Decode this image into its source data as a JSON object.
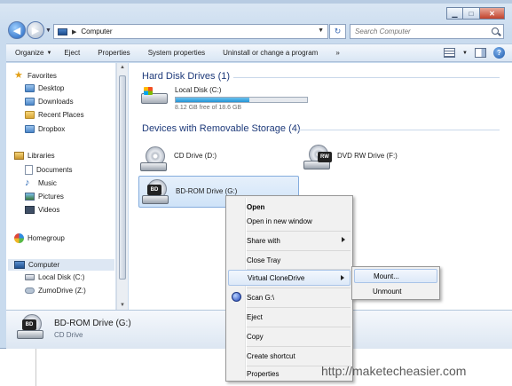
{
  "window": {
    "address": "Computer",
    "search_placeholder": "Search Computer"
  },
  "toolbar": {
    "organize": "Organize",
    "eject": "Eject",
    "properties": "Properties",
    "system_properties": "System properties",
    "uninstall": "Uninstall or change a program",
    "more": "»"
  },
  "nav": {
    "favorites": "Favorites",
    "desktop": "Desktop",
    "downloads": "Downloads",
    "recent": "Recent Places",
    "dropbox": "Dropbox",
    "libraries": "Libraries",
    "documents": "Documents",
    "music": "Music",
    "pictures": "Pictures",
    "videos": "Videos",
    "homegroup": "Homegroup",
    "computer": "Computer",
    "local_disk": "Local Disk (C:)",
    "zumodrive": "ZumoDrive (Z:)"
  },
  "content": {
    "hdd_group": "Hard Disk Drives (1)",
    "local_disk_label": "Local Disk (C:)",
    "local_disk_free": "8.12 GB free of 18.6 GB",
    "local_disk_used_fraction": 0.56,
    "removable_group": "Devices with Removable Storage (4)",
    "cd_drive": "CD Drive (D:)",
    "dvd_drive": "DVD RW Drive (F:)",
    "bdrom_drive": "BD-ROM Drive (G:)",
    "cd_badge_bd": "BD",
    "cd_badge_rw": "RW"
  },
  "details": {
    "title": "BD-ROM Drive (G:)",
    "subtitle": "CD Drive"
  },
  "context_menu": {
    "open": "Open",
    "open_new_window": "Open in new window",
    "share_with": "Share with",
    "close_tray": "Close Tray",
    "virtual_clonedrive": "Virtual CloneDrive",
    "scan": "Scan G:\\",
    "eject": "Eject",
    "copy": "Copy",
    "create_shortcut": "Create shortcut",
    "properties": "Properties"
  },
  "submenu": {
    "mount": "Mount...",
    "unmount": "Unmount"
  },
  "watermark": "http://maketecheasier.com"
}
